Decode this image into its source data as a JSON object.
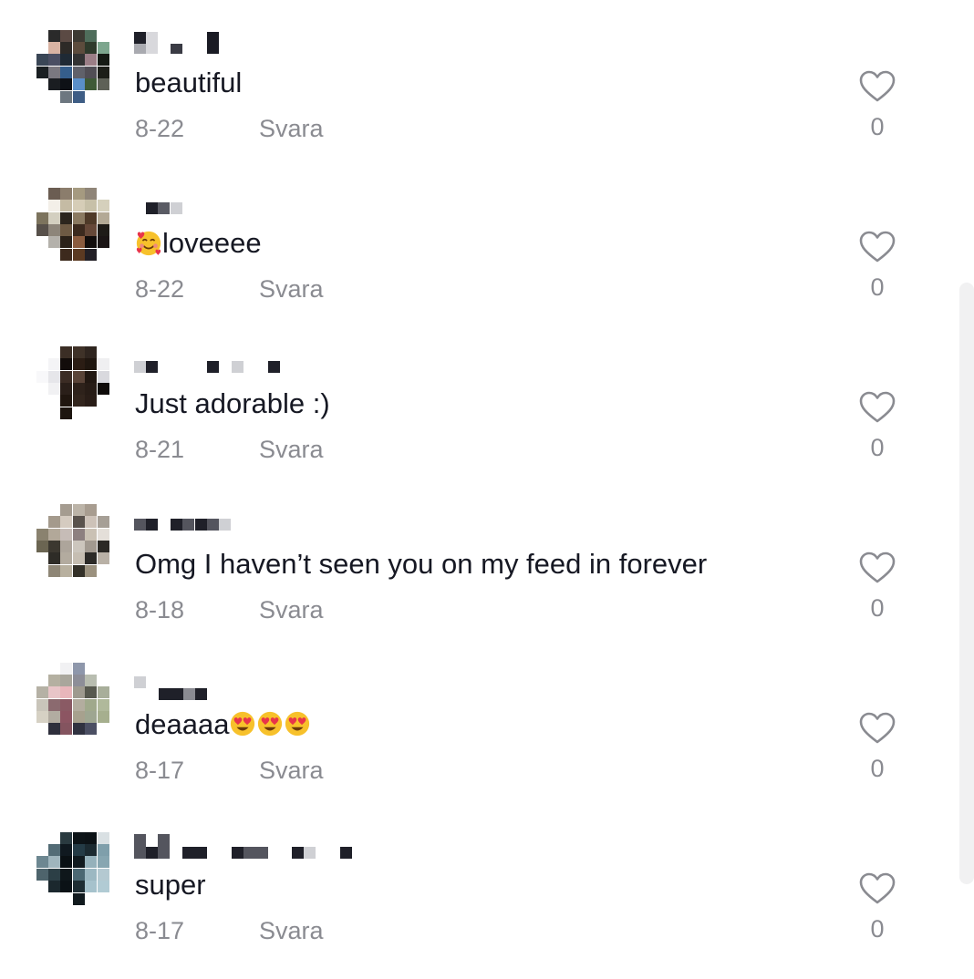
{
  "comments": [
    {
      "text": "beautiful",
      "date": "8-22",
      "reply": "Svara",
      "likes": "0"
    },
    {
      "text": "loveeee",
      "date": "8-22",
      "reply": "Svara",
      "likes": "0",
      "leading_emoji": "smiling-face-with-hearts"
    },
    {
      "text": "Just adorable :)",
      "date": "8-21",
      "reply": "Svara",
      "likes": "0"
    },
    {
      "text": "Omg I haven’t seen you on my feed in forever",
      "date": "8-18",
      "reply": "Svara",
      "likes": "0"
    },
    {
      "text": "deaaaa",
      "date": "8-17",
      "reply": "Svara",
      "likes": "0",
      "trailing_emoji": [
        "heart-eyes",
        "heart-eyes",
        "heart-eyes"
      ]
    },
    {
      "text": "super",
      "date": "8-17",
      "reply": "Svara",
      "likes": "0"
    }
  ],
  "colors": {
    "text": "#161823",
    "meta": "#8a8b91",
    "scrollbar": "#f1f1f2"
  }
}
